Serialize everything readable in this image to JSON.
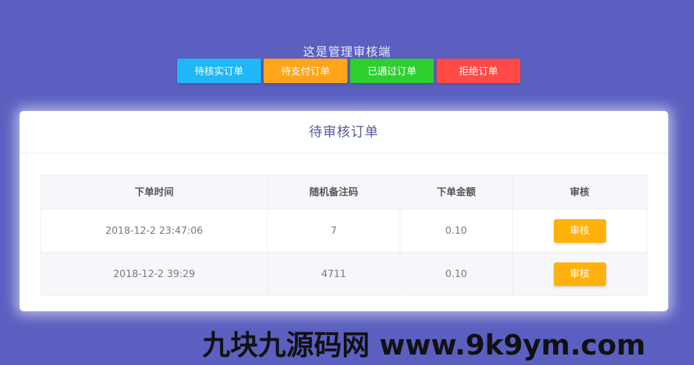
{
  "header": {
    "title": "这是管理审核端"
  },
  "tabs": [
    {
      "label": "待核实订单",
      "color": "#1fb7f5"
    },
    {
      "label": "待支付订单",
      "color": "#ffa51a"
    },
    {
      "label": "已通过订单",
      "color": "#2ecf2f"
    },
    {
      "label": "拒绝订单",
      "color": "#ff4a45"
    }
  ],
  "card": {
    "title": "待审核订单",
    "columns": [
      "下单时间",
      "随机备注码",
      "下单金额",
      "审核"
    ],
    "rows": [
      {
        "time": "2018-12-2 23:47:06",
        "code": "7",
        "amount": "0.10",
        "action": "审核"
      },
      {
        "time": "2018-12-2 39:29",
        "code": "4711",
        "amount": "0.10",
        "action": "审核"
      }
    ]
  },
  "watermark": {
    "text": "九块九源码网 www.9k9ym.com"
  },
  "colors": {
    "background": "#5b5fc0",
    "review_button": "#ffb10d"
  }
}
